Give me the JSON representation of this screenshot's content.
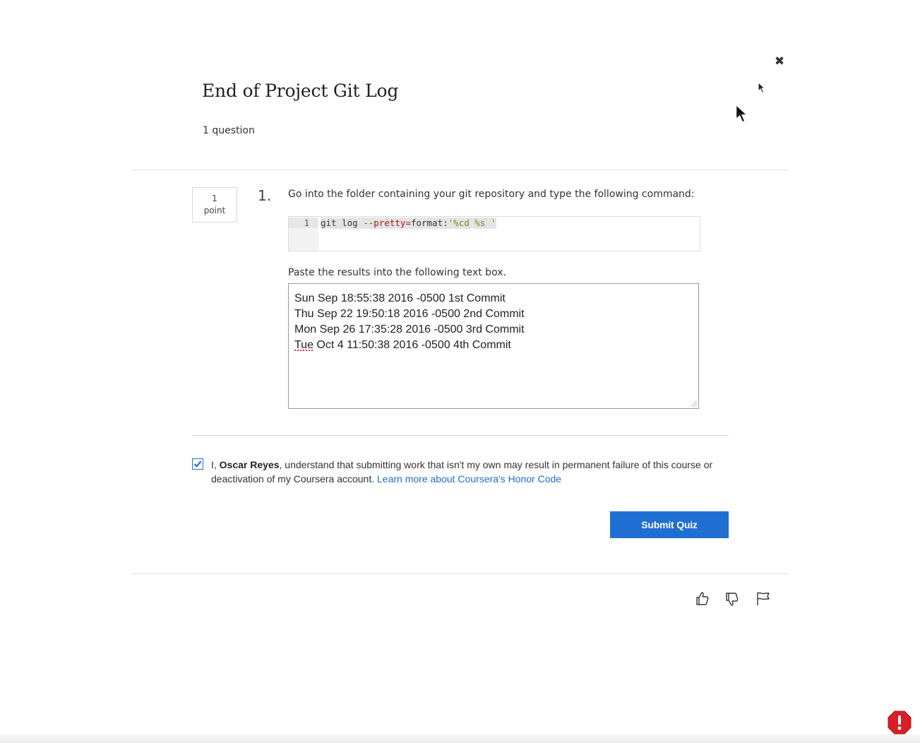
{
  "modal": {
    "close_symbol": "✖",
    "title": "End of Project Git Log",
    "question_count": "1 question"
  },
  "question": {
    "points_value": "1",
    "points_unit": "point",
    "number": "1.",
    "prompt": "Go into the folder containing your git repository and type the following command:",
    "code": {
      "line_number": "1",
      "segments": {
        "cmd": "git log ",
        "dash": "--",
        "opt": "pretty",
        "eq": "=",
        "fmt": "format:",
        "str": "'%cd %s '"
      }
    },
    "paste_label": "Paste the results into the following text box.",
    "answer_lines": {
      "l1": "Sun Sep 18:55:38 2016 -0500 1st Commit",
      "l2": "Thu Sep 22 19:50:18 2016 -0500 2nd Commit",
      "l3": "Mon Sep 26 17:35:28 2016 -0500 3rd Commit",
      "l4_flagged": "Tue",
      "l4_rest": " Oct 4 11:50:38 2016 -0500 4th Commit"
    }
  },
  "honor_code": {
    "checked": true,
    "prefix": "I, ",
    "name": "Oscar Reyes",
    "statement": ", understand that submitting work that isn't my own may result in permanent failure of this course or deactivation of my Coursera account. ",
    "link_text": "Learn more about Coursera's Honor Code"
  },
  "actions": {
    "submit_label": "Submit Quiz"
  },
  "feedback": {
    "icons": [
      "thumbs-up-icon",
      "thumbs-down-icon",
      "flag-icon"
    ]
  },
  "colors": {
    "accent": "#1f6fd2",
    "link": "#1f6fcf",
    "alert": "#d91f26"
  }
}
